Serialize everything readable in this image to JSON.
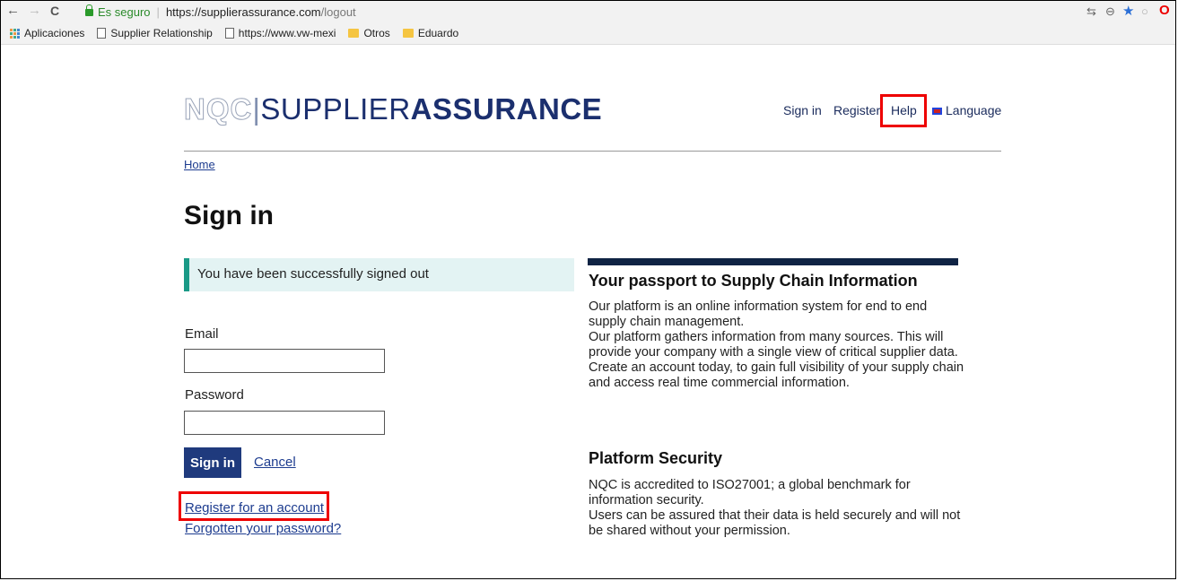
{
  "browser": {
    "back": "←",
    "forward": "→",
    "reload": "C",
    "secure_label": "Es seguro",
    "url_host": "https://supplierassurance.com",
    "url_path": "/logout",
    "icons": [
      "translate-icon",
      "zoom-icon",
      "bookmark-star-icon",
      "extension-icon",
      "opera-icon"
    ]
  },
  "bookmarks": {
    "apps": "Aplicaciones",
    "items": [
      {
        "label": "Supplier Relationship",
        "icon": "page-icon"
      },
      {
        "label": "https://www.vw-mexi",
        "icon": "page-icon"
      },
      {
        "label": "Otros",
        "icon": "folder-icon"
      },
      {
        "label": "Eduardo",
        "icon": "folder-icon"
      }
    ]
  },
  "header": {
    "logo_nqc": "NQC",
    "logo_bar": "|",
    "logo_supplier": "SUPPLIER",
    "logo_assurance": "ASSURANCE",
    "nav": {
      "sign_in": "Sign in",
      "register": "Register",
      "help": "Help",
      "language": "Language"
    }
  },
  "breadcrumb": {
    "home": "Home"
  },
  "page_title": "Sign in",
  "alert": "You have been successfully signed out",
  "form": {
    "email_label": "Email",
    "email_value": "",
    "password_label": "Password",
    "password_value": "",
    "signin_button": "Sign in",
    "cancel_link": "Cancel",
    "register_link": "Register for an account",
    "forgot_link": "Forgotten your password?"
  },
  "info": {
    "heading1": "Your passport to Supply Chain Information",
    "para1a": "Our platform is an online information system for end to end supply chain management.",
    "para1b": "Our platform gathers information from many sources. This will provide your company with a single view of critical supplier data.",
    "para1c": "Create an account today, to gain full visibility of your supply chain and access real time commercial information.",
    "heading2": "Platform Security",
    "para2a": "NQC is accredited to ISO27001; a global benchmark for information security.",
    "para2b": "Users can be assured that their data is held securely and will not be shared without your permission."
  },
  "colors": {
    "brand": "#1b2f6e",
    "button": "#1f3a7d",
    "alert_border": "#1a9a87",
    "highlight": "#e00000"
  }
}
